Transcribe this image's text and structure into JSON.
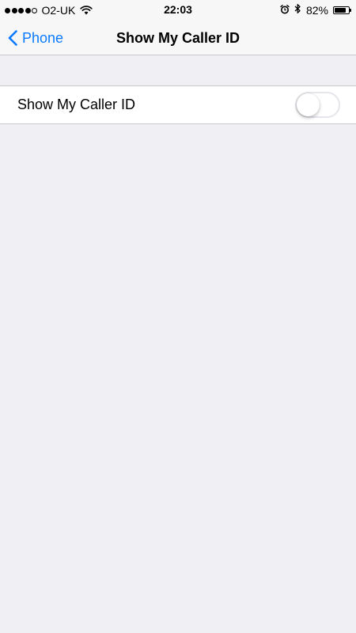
{
  "status_bar": {
    "signal_dots_filled": 4,
    "signal_dots_total": 5,
    "carrier": "O2-UK",
    "time": "22:03",
    "battery_percent": "82%",
    "battery_level": 0.82,
    "icons": [
      "wifi-icon",
      "alarm-icon",
      "bluetooth-icon",
      "battery-icon"
    ]
  },
  "nav": {
    "back_label": "Phone",
    "title": "Show My Caller ID"
  },
  "settings": {
    "show_caller_id": {
      "label": "Show My Caller ID",
      "enabled": false
    }
  },
  "colors": {
    "accent": "#0a7aff",
    "background": "#efeff4",
    "toggle_off_border": "#e5e5ea"
  }
}
